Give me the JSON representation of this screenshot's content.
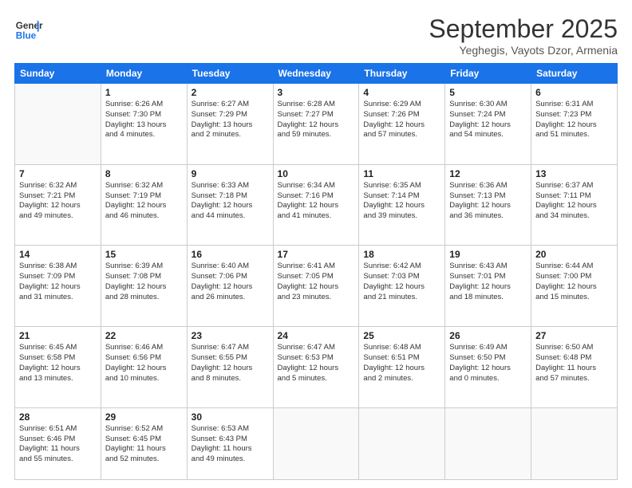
{
  "header": {
    "logo_line1": "General",
    "logo_line2": "Blue",
    "month": "September 2025",
    "location": "Yeghegis, Vayots Dzor, Armenia"
  },
  "weekdays": [
    "Sunday",
    "Monday",
    "Tuesday",
    "Wednesday",
    "Thursday",
    "Friday",
    "Saturday"
  ],
  "weeks": [
    [
      {
        "day": "",
        "info": ""
      },
      {
        "day": "1",
        "info": "Sunrise: 6:26 AM\nSunset: 7:30 PM\nDaylight: 13 hours\nand 4 minutes."
      },
      {
        "day": "2",
        "info": "Sunrise: 6:27 AM\nSunset: 7:29 PM\nDaylight: 13 hours\nand 2 minutes."
      },
      {
        "day": "3",
        "info": "Sunrise: 6:28 AM\nSunset: 7:27 PM\nDaylight: 12 hours\nand 59 minutes."
      },
      {
        "day": "4",
        "info": "Sunrise: 6:29 AM\nSunset: 7:26 PM\nDaylight: 12 hours\nand 57 minutes."
      },
      {
        "day": "5",
        "info": "Sunrise: 6:30 AM\nSunset: 7:24 PM\nDaylight: 12 hours\nand 54 minutes."
      },
      {
        "day": "6",
        "info": "Sunrise: 6:31 AM\nSunset: 7:23 PM\nDaylight: 12 hours\nand 51 minutes."
      }
    ],
    [
      {
        "day": "7",
        "info": "Sunrise: 6:32 AM\nSunset: 7:21 PM\nDaylight: 12 hours\nand 49 minutes."
      },
      {
        "day": "8",
        "info": "Sunrise: 6:32 AM\nSunset: 7:19 PM\nDaylight: 12 hours\nand 46 minutes."
      },
      {
        "day": "9",
        "info": "Sunrise: 6:33 AM\nSunset: 7:18 PM\nDaylight: 12 hours\nand 44 minutes."
      },
      {
        "day": "10",
        "info": "Sunrise: 6:34 AM\nSunset: 7:16 PM\nDaylight: 12 hours\nand 41 minutes."
      },
      {
        "day": "11",
        "info": "Sunrise: 6:35 AM\nSunset: 7:14 PM\nDaylight: 12 hours\nand 39 minutes."
      },
      {
        "day": "12",
        "info": "Sunrise: 6:36 AM\nSunset: 7:13 PM\nDaylight: 12 hours\nand 36 minutes."
      },
      {
        "day": "13",
        "info": "Sunrise: 6:37 AM\nSunset: 7:11 PM\nDaylight: 12 hours\nand 34 minutes."
      }
    ],
    [
      {
        "day": "14",
        "info": "Sunrise: 6:38 AM\nSunset: 7:09 PM\nDaylight: 12 hours\nand 31 minutes."
      },
      {
        "day": "15",
        "info": "Sunrise: 6:39 AM\nSunset: 7:08 PM\nDaylight: 12 hours\nand 28 minutes."
      },
      {
        "day": "16",
        "info": "Sunrise: 6:40 AM\nSunset: 7:06 PM\nDaylight: 12 hours\nand 26 minutes."
      },
      {
        "day": "17",
        "info": "Sunrise: 6:41 AM\nSunset: 7:05 PM\nDaylight: 12 hours\nand 23 minutes."
      },
      {
        "day": "18",
        "info": "Sunrise: 6:42 AM\nSunset: 7:03 PM\nDaylight: 12 hours\nand 21 minutes."
      },
      {
        "day": "19",
        "info": "Sunrise: 6:43 AM\nSunset: 7:01 PM\nDaylight: 12 hours\nand 18 minutes."
      },
      {
        "day": "20",
        "info": "Sunrise: 6:44 AM\nSunset: 7:00 PM\nDaylight: 12 hours\nand 15 minutes."
      }
    ],
    [
      {
        "day": "21",
        "info": "Sunrise: 6:45 AM\nSunset: 6:58 PM\nDaylight: 12 hours\nand 13 minutes."
      },
      {
        "day": "22",
        "info": "Sunrise: 6:46 AM\nSunset: 6:56 PM\nDaylight: 12 hours\nand 10 minutes."
      },
      {
        "day": "23",
        "info": "Sunrise: 6:47 AM\nSunset: 6:55 PM\nDaylight: 12 hours\nand 8 minutes."
      },
      {
        "day": "24",
        "info": "Sunrise: 6:47 AM\nSunset: 6:53 PM\nDaylight: 12 hours\nand 5 minutes."
      },
      {
        "day": "25",
        "info": "Sunrise: 6:48 AM\nSunset: 6:51 PM\nDaylight: 12 hours\nand 2 minutes."
      },
      {
        "day": "26",
        "info": "Sunrise: 6:49 AM\nSunset: 6:50 PM\nDaylight: 12 hours\nand 0 minutes."
      },
      {
        "day": "27",
        "info": "Sunrise: 6:50 AM\nSunset: 6:48 PM\nDaylight: 11 hours\nand 57 minutes."
      }
    ],
    [
      {
        "day": "28",
        "info": "Sunrise: 6:51 AM\nSunset: 6:46 PM\nDaylight: 11 hours\nand 55 minutes."
      },
      {
        "day": "29",
        "info": "Sunrise: 6:52 AM\nSunset: 6:45 PM\nDaylight: 11 hours\nand 52 minutes."
      },
      {
        "day": "30",
        "info": "Sunrise: 6:53 AM\nSunset: 6:43 PM\nDaylight: 11 hours\nand 49 minutes."
      },
      {
        "day": "",
        "info": ""
      },
      {
        "day": "",
        "info": ""
      },
      {
        "day": "",
        "info": ""
      },
      {
        "day": "",
        "info": ""
      }
    ]
  ]
}
